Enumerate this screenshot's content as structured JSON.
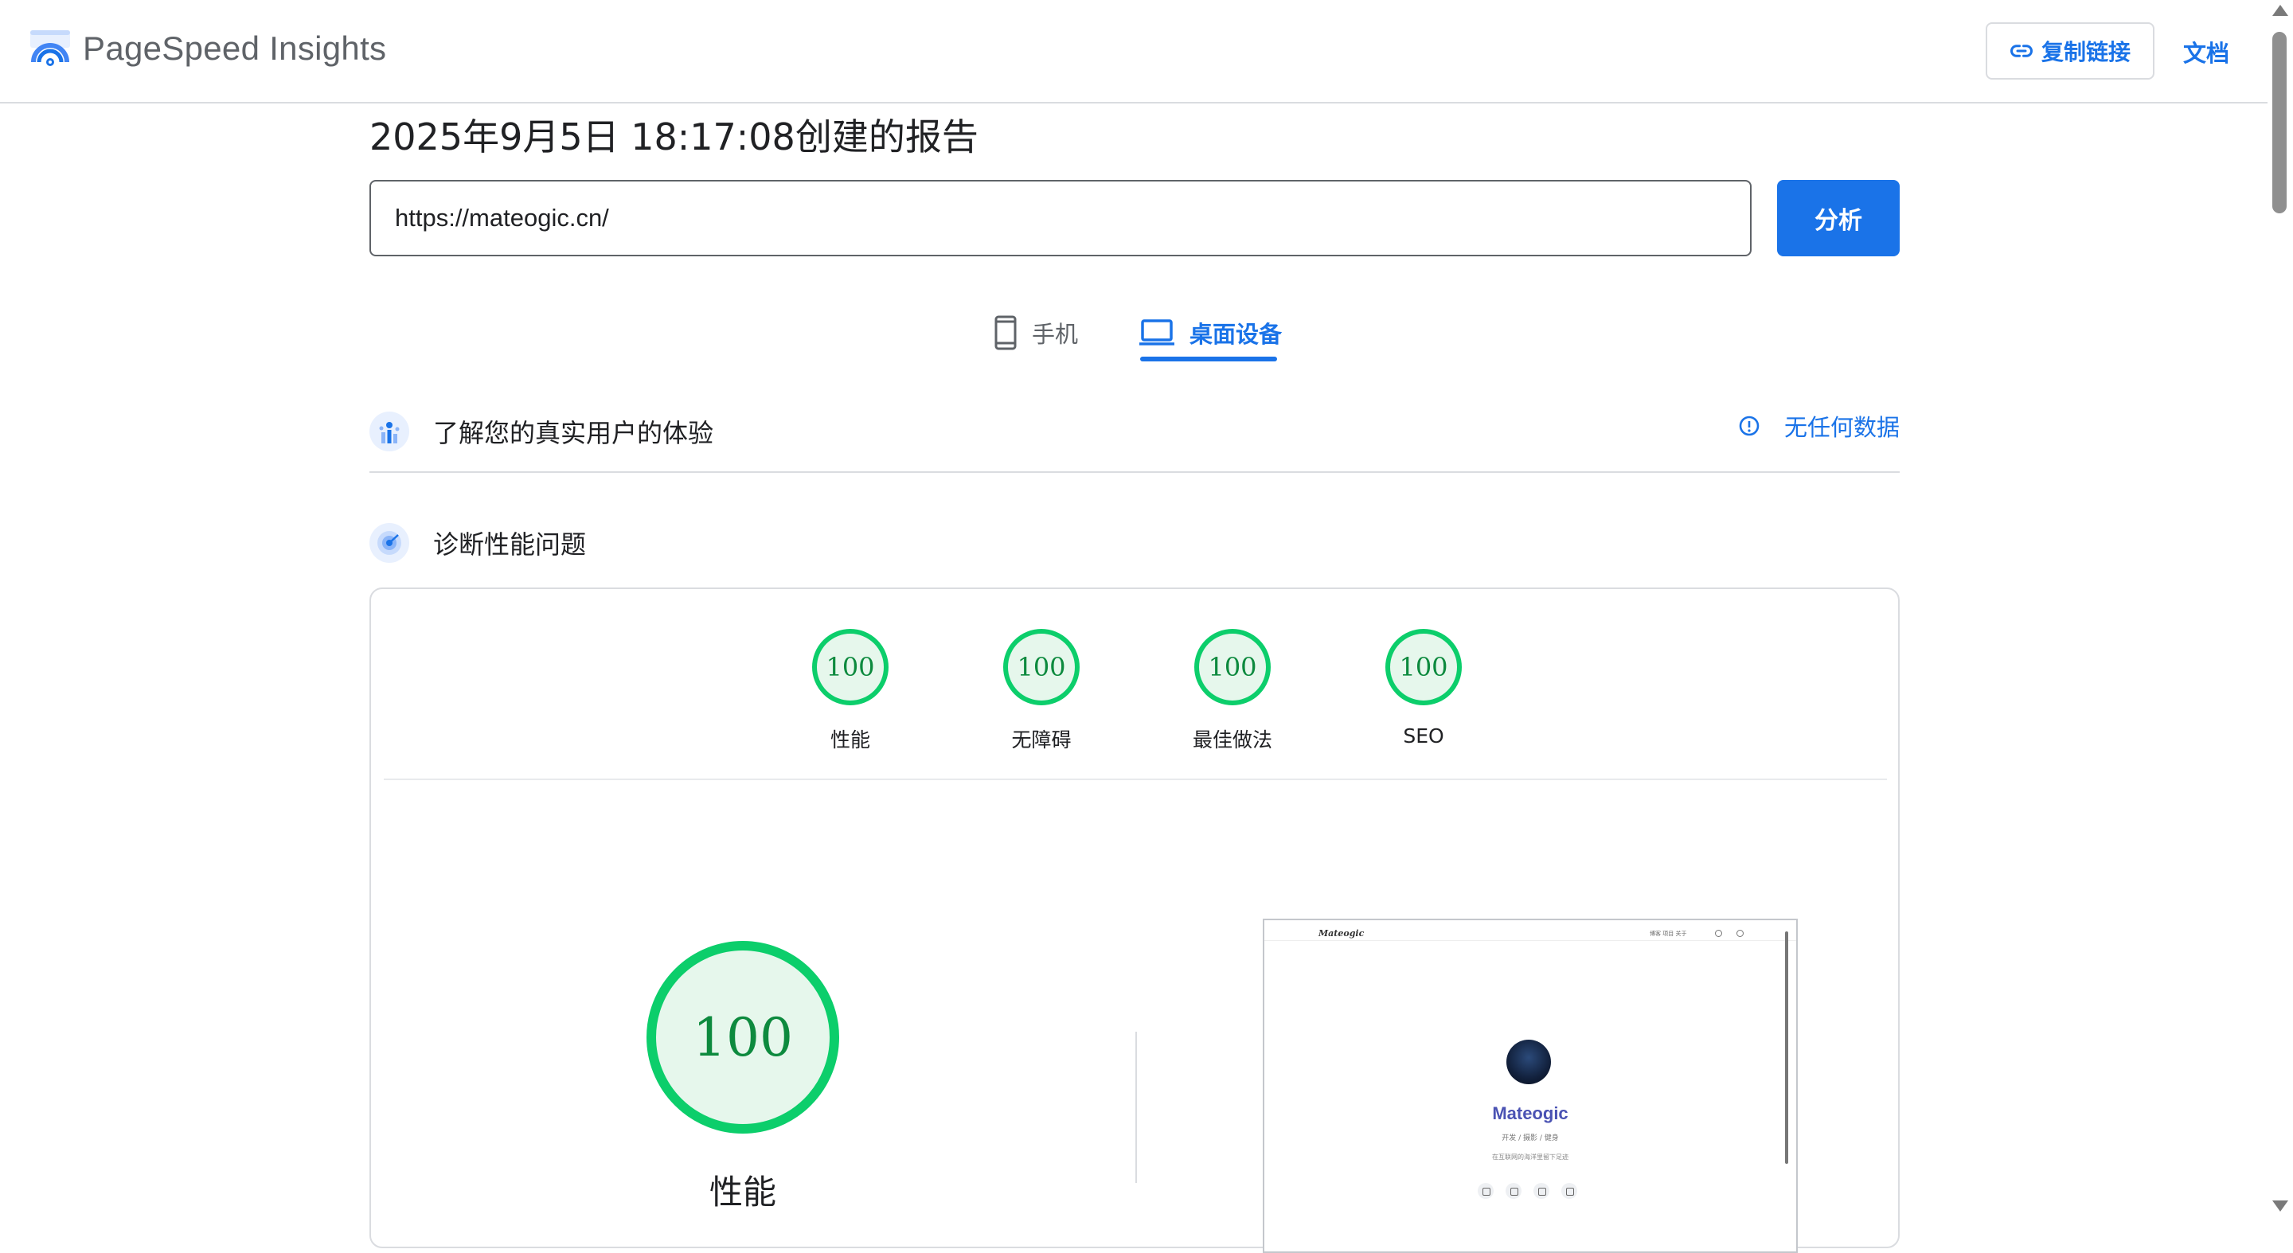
{
  "header": {
    "app_title": "PageSpeed Insights",
    "copy_link_label": "复制链接",
    "docs_label": "文档"
  },
  "report": {
    "title": "2025年9月5日 18:17:08创建的报告",
    "url_value": "https://mateogic.cn/",
    "analyze_label": "分析"
  },
  "tabs": [
    {
      "label": "手机",
      "icon": "smartphone-icon",
      "selected": false
    },
    {
      "label": "桌面设备",
      "icon": "laptop-icon",
      "selected": true
    }
  ],
  "field_data": {
    "title": "了解您的真实用户的体验",
    "status": "无任何数据",
    "status_icon": "info-icon"
  },
  "diagnostics": {
    "title": "诊断性能问题",
    "scores": [
      {
        "label": "性能",
        "value": "100"
      },
      {
        "label": "无障碍",
        "value": "100"
      },
      {
        "label": "最佳做法",
        "value": "100"
      },
      {
        "label": "SEO",
        "value": "100"
      }
    ],
    "main_score": {
      "label": "性能",
      "value": "100"
    },
    "colors": {
      "pass": "#0cce6b",
      "pass_text": "#0d8a3e",
      "pass_fill": "#e6f7ec",
      "accent": "#1a73e8"
    }
  },
  "screenshot": {
    "logo_text": "Mateogic",
    "nav_links": "博客  项目  关于",
    "site_name": "Mateogic",
    "tags": "开发 / 摄影 / 健身",
    "description": "在互联网的海洋里留下足迹"
  }
}
